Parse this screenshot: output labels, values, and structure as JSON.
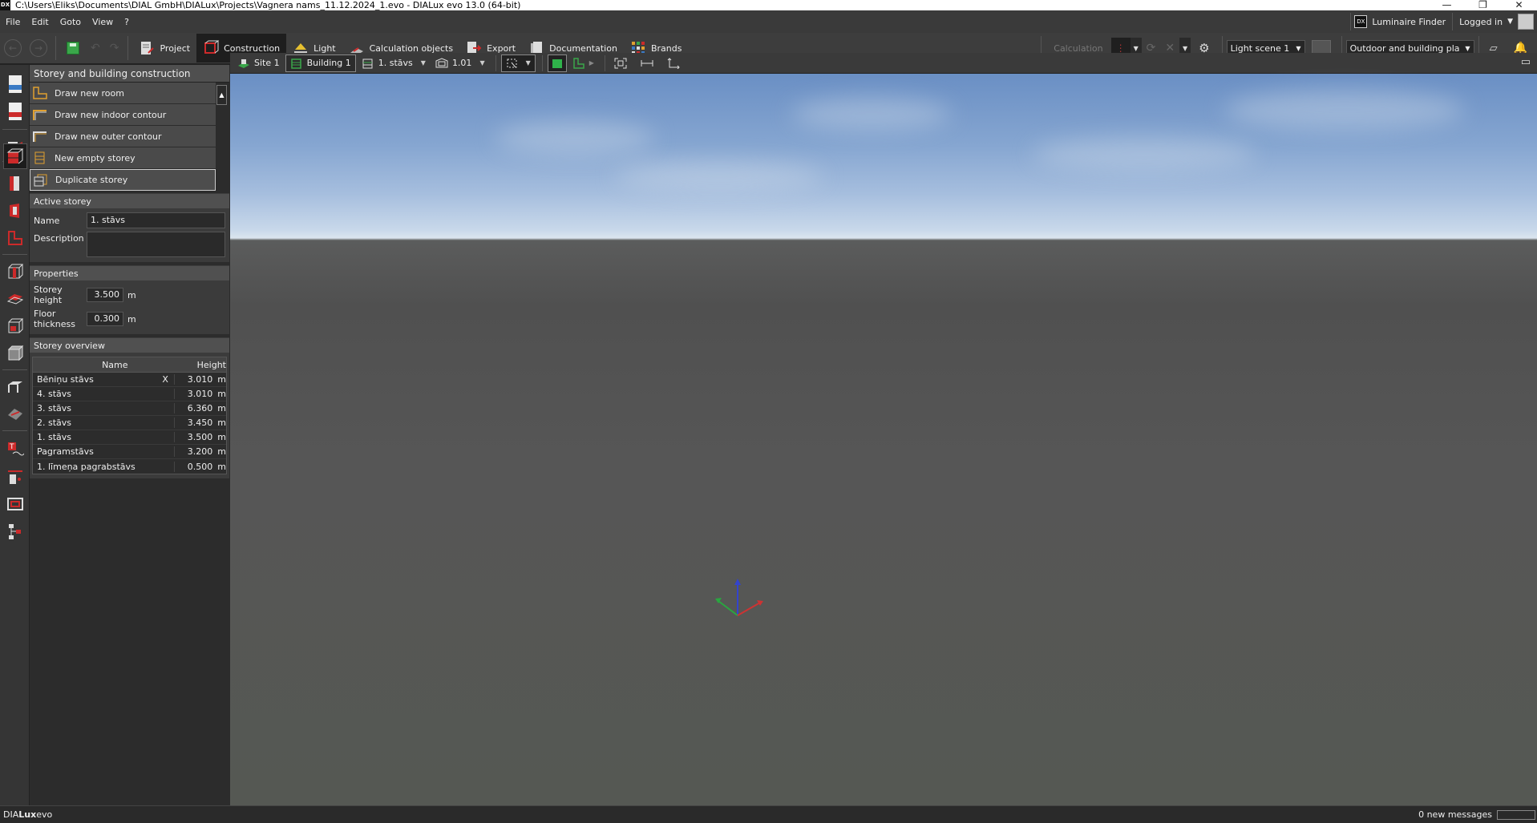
{
  "window": {
    "app_icon": "DX",
    "title": "C:\\Users\\Eliks\\Documents\\DIAL GmbH\\DIALux\\Projects\\Vagnera nams_11.12.2024_1.evo - DIALux evo 13.0  (64-bit)",
    "controls": [
      "minimize-icon",
      "restore-icon",
      "close-icon"
    ]
  },
  "menubar": {
    "items": [
      "File",
      "Edit",
      "Goto",
      "View",
      "?"
    ],
    "luminaire_finder": "Luminaire Finder",
    "luminaire_finder_icon": "DX",
    "logged_in": "Logged in"
  },
  "toolbar": {
    "tabs": [
      {
        "label": "Project",
        "icon": "project-icon"
      },
      {
        "label": "Construction",
        "icon": "construction-icon"
      },
      {
        "label": "Light",
        "icon": "light-icon"
      },
      {
        "label": "Calculation objects",
        "icon": "calc-objects-icon"
      },
      {
        "label": "Export",
        "icon": "export-icon"
      },
      {
        "label": "Documentation",
        "icon": "documentation-icon"
      },
      {
        "label": "Brands",
        "icon": "brands-icon"
      }
    ],
    "active_tab": "Construction",
    "calculation_label": "Calculation",
    "light_scene": "Light scene 1",
    "view_mode": "Outdoor and building pla..."
  },
  "panel": {
    "title": "Storey and building construction",
    "actions": [
      {
        "label": "Draw new room",
        "icon": "draw-room-icon"
      },
      {
        "label": "Draw new indoor contour",
        "icon": "indoor-contour-icon"
      },
      {
        "label": "Draw new outer contour",
        "icon": "outer-contour-icon"
      },
      {
        "label": "New empty storey",
        "icon": "empty-storey-icon"
      },
      {
        "label": "Duplicate storey",
        "icon": "duplicate-storey-icon"
      }
    ],
    "active_storey": {
      "header": "Active storey",
      "name_label": "Name",
      "name_value": "1. stāvs",
      "description_label": "Description",
      "description_value": ""
    },
    "properties": {
      "header": "Properties",
      "storey_height_label": "Storey height",
      "storey_height_value": "3.500",
      "floor_thickness_label": "Floor thickness",
      "floor_thickness_value": "0.300",
      "unit": "m"
    },
    "overview": {
      "header": "Storey overview",
      "col_name": "Name",
      "col_height": "Height",
      "rows": [
        {
          "name": "Bēniņu stāvs",
          "x": "X",
          "height": "3.010",
          "unit": "m"
        },
        {
          "name": "4. stāvs",
          "x": "",
          "height": "3.010",
          "unit": "m"
        },
        {
          "name": "3. stāvs",
          "x": "",
          "height": "6.360",
          "unit": "m"
        },
        {
          "name": "2. stāvs",
          "x": "",
          "height": "3.450",
          "unit": "m"
        },
        {
          "name": "1. stāvs",
          "x": "",
          "height": "3.500",
          "unit": "m"
        },
        {
          "name": "Pagramstāvs",
          "x": "",
          "height": "3.200",
          "unit": "m"
        },
        {
          "name": "1. līmeņa pagrabstāvs",
          "x": "",
          "height": "0.500",
          "unit": "m"
        }
      ]
    }
  },
  "view_toolbar": {
    "site": "Site 1",
    "building": "Building 1",
    "storey": "1. stāvs",
    "room": "1.01"
  },
  "statusbar": {
    "brand_prefix": "DIA",
    "brand_bold": "Lux",
    "brand_suffix": "evo",
    "messages": "0 new messages"
  },
  "colors": {
    "accent_red": "#cc2a2a",
    "accent_orange": "#e0a030",
    "accent_green": "#3aa64a",
    "panel_bg": "#2c2c2c"
  }
}
